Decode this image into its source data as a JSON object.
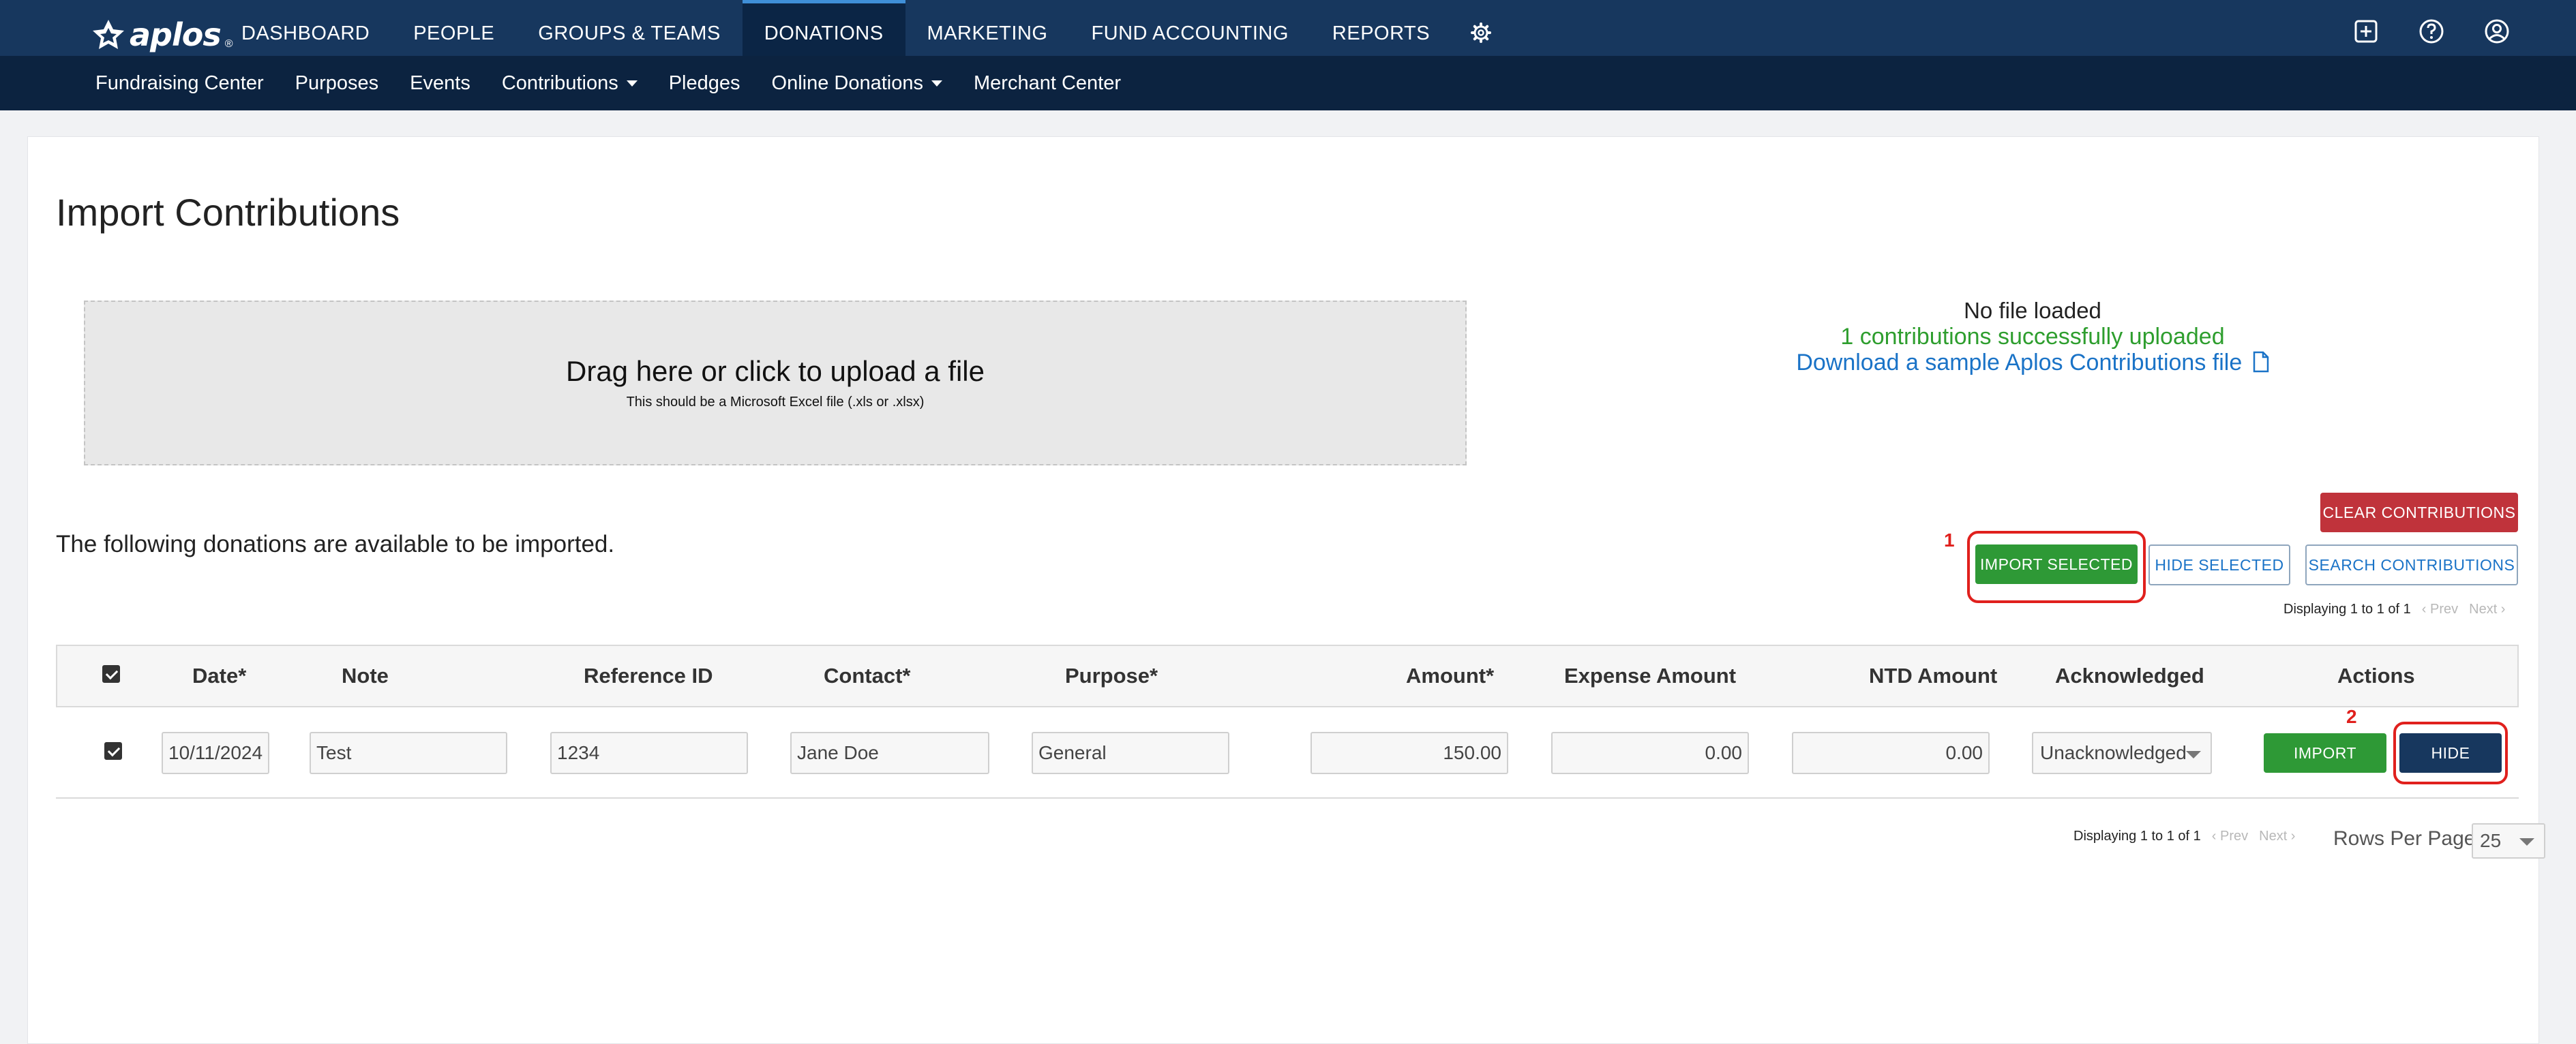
{
  "brand": {
    "name": "aplos",
    "reg": "®"
  },
  "main_nav": [
    "DASHBOARD",
    "PEOPLE",
    "GROUPS & TEAMS",
    "DONATIONS",
    "MARKETING",
    "FUND ACCOUNTING",
    "REPORTS"
  ],
  "main_nav_active": "DONATIONS",
  "sub_nav": {
    "fundraising_center": "Fundraising Center",
    "purposes": "Purposes",
    "events": "Events",
    "contributions": "Contributions",
    "pledges": "Pledges",
    "online_donations": "Online Donations",
    "merchant_center": "Merchant Center"
  },
  "page": {
    "title": "Import Contributions",
    "dropzone_title": "Drag here or click to upload a file",
    "dropzone_sub": "This should be a Microsoft Excel file (.xls or .xlsx)",
    "no_file": "No file loaded",
    "success_msg": "1 contributions successfully uploaded",
    "download_link": "Download a sample Aplos Contributions file",
    "available_text": "The following donations are available to be imported."
  },
  "buttons": {
    "clear": "CLEAR CONTRIBUTIONS",
    "import_selected": "IMPORT SELECTED",
    "hide_selected": "HIDE SELECTED",
    "search": "SEARCH CONTRIBUTIONS",
    "row_import": "IMPORT",
    "row_hide": "HIDE"
  },
  "annotations": {
    "first": "1",
    "second": "2"
  },
  "paging": {
    "text": "Displaying 1 to 1 of 1",
    "prev": "‹ Prev",
    "next": "Next ›"
  },
  "table": {
    "headers": {
      "date": "Date*",
      "note": "Note",
      "reference": "Reference ID",
      "contact": "Contact*",
      "purpose": "Purpose*",
      "amount": "Amount*",
      "expense": "Expense Amount",
      "ntd": "NTD Amount",
      "acknowledged": "Acknowledged",
      "actions": "Actions"
    },
    "row": {
      "checked": true,
      "date": "10/11/2024",
      "note": "Test",
      "reference": "1234",
      "contact": "Jane Doe",
      "purpose": "General",
      "amount": "150.00",
      "expense": "0.00",
      "ntd": "0.00",
      "acknowledged": "Unacknowledged"
    }
  },
  "rows_per_page": {
    "label": "Rows Per Page:",
    "value": "25"
  },
  "colors": {
    "nav": "#17375e",
    "subnav": "#0c2340",
    "success": "#2e9e2e",
    "danger": "#c0333b",
    "link": "#1a73c7",
    "annotation": "#e0201d"
  }
}
